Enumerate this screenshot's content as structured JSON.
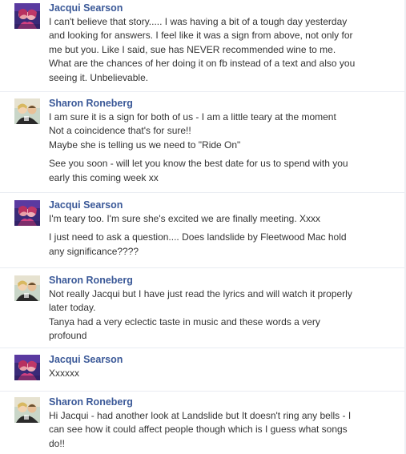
{
  "messages": [
    {
      "author": "Jacqui Searson",
      "avatar": "jacqui-avatar",
      "paragraphs": [
        [
          "I can't believe that story..... I was having a bit of a tough day yesterday",
          "and looking for answers.  I feel like it was a sign from above, not only for",
          "me but you. Like I said, sue has NEVER recommended wine to me.",
          "What are the chances of her doing it on fb instead of a text and also you",
          "seeing it. Unbelievable."
        ]
      ]
    },
    {
      "author": "Sharon Roneberg",
      "avatar": "sharon-avatar",
      "paragraphs": [
        [
          "I am sure it is a sign for both of us - I am a little teary at the moment",
          "Not a coincidence that's for sure!!",
          "Maybe she is telling us we need to \"Ride On\""
        ],
        [
          "See you soon - will let you know the best date for us to spend with you",
          "early this coming week xx"
        ]
      ]
    },
    {
      "author": "Jacqui Searson",
      "avatar": "jacqui-avatar",
      "paragraphs": [
        [
          "I'm teary too. I'm sure she's excited we are finally meeting. Xxxx"
        ],
        [
          "I just need to ask a question.... Does landslide by Fleetwood Mac hold",
          "any significance????"
        ]
      ]
    },
    {
      "author": "Sharon Roneberg",
      "avatar": "sharon-avatar",
      "paragraphs": [
        [
          "Not really Jacqui but I have just read the lyrics and will watch it properly",
          "later today.",
          "Tanya had a very eclectic taste in music and these words a very",
          "profound"
        ]
      ]
    },
    {
      "author": "Jacqui Searson",
      "avatar": "jacqui-avatar",
      "paragraphs": [
        [
          "Xxxxxx"
        ]
      ]
    },
    {
      "author": "Sharon Roneberg",
      "avatar": "sharon-avatar",
      "paragraphs": [
        [
          "Hi Jacqui - had another look at Landslide but It doesn't ring any bells - I",
          "can see how it could affect people though which is I guess what songs",
          "do!!"
        ]
      ]
    }
  ],
  "colors": {
    "author": "#3b5998",
    "text": "#333333",
    "divider": "#e9ecf2"
  }
}
